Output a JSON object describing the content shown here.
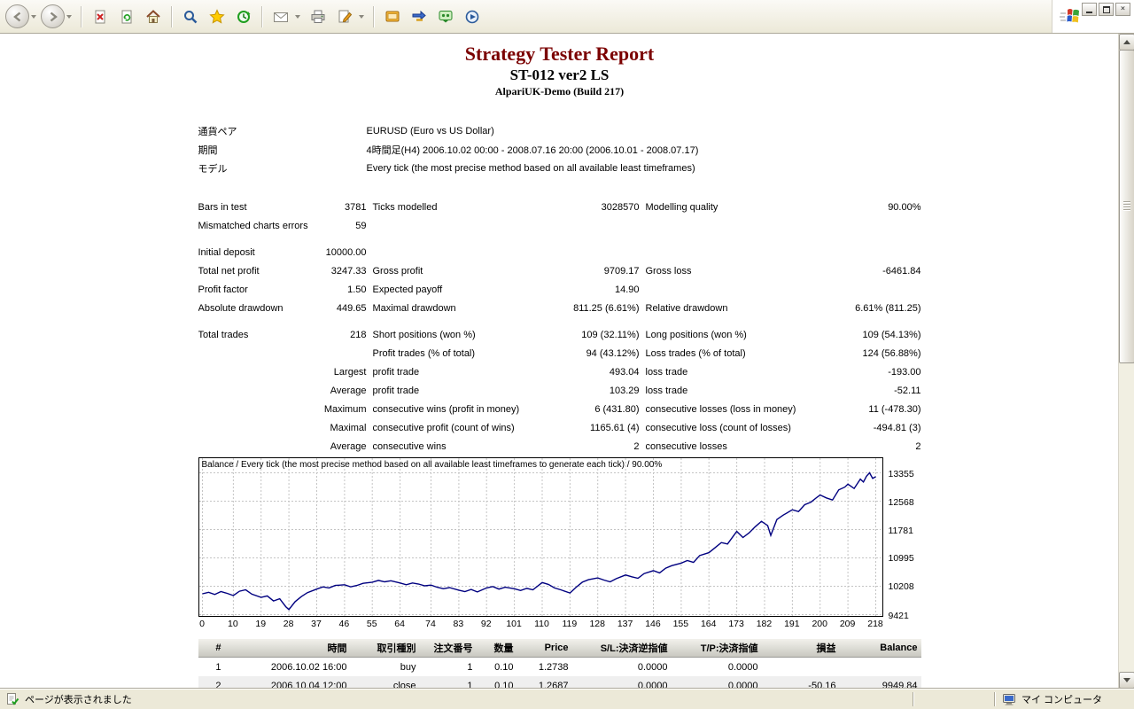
{
  "browser": {
    "toolbar_icons": [
      "back-icon",
      "forward-icon",
      "stop-icon",
      "refresh-icon",
      "home-icon",
      "search-icon",
      "favorites-icon",
      "history-icon",
      "mail-icon",
      "print-icon",
      "edit-icon",
      "tool-icon",
      "transfer-icon",
      "messenger-icon",
      "media-icon"
    ],
    "window_buttons": [
      "minimize",
      "restore",
      "close"
    ],
    "status": {
      "left": "ページが表示されました",
      "zone": "マイ コンピュータ"
    }
  },
  "report": {
    "title": "Strategy Tester Report",
    "subtitle": "ST-012 ver2 LS",
    "server": "AlpariUK-Demo (Build 217)",
    "info": [
      {
        "label": "通貨ペア",
        "value": "EURUSD (Euro vs US Dollar)"
      },
      {
        "label": "期間",
        "value": "4時間足(H4) 2006.10.02 00:00 - 2008.07.16 20:00 (2006.10.01 - 2008.07.17)"
      },
      {
        "label": "モデル",
        "value": "Every tick (the most precise method based on all available least timeframes)"
      }
    ],
    "stats_rows": [
      [
        "Bars in test",
        "3781",
        "Ticks modelled",
        "3028570",
        "Modelling quality",
        "90.00%"
      ],
      [
        "Mismatched charts errors",
        "59",
        "",
        "",
        "",
        ""
      ],
      [],
      [
        "Initial deposit",
        "10000.00",
        "",
        "",
        "",
        ""
      ],
      [
        "Total net profit",
        "3247.33",
        "Gross profit",
        "9709.17",
        "Gross loss",
        "-6461.84"
      ],
      [
        "Profit factor",
        "1.50",
        "Expected payoff",
        "14.90",
        "",
        ""
      ],
      [
        "Absolute drawdown",
        "449.65",
        "Maximal drawdown",
        "811.25 (6.61%)",
        "Relative drawdown",
        "6.61% (811.25)"
      ],
      [],
      [
        "Total trades",
        "218",
        "Short positions (won %)",
        "109 (32.11%)",
        "Long positions (won %)",
        "109 (54.13%)"
      ],
      [
        "",
        "",
        "Profit trades (% of total)",
        "94 (43.12%)",
        "Loss trades (% of total)",
        "124 (56.88%)"
      ],
      [
        "",
        "Largest",
        "profit trade",
        "493.04",
        "loss trade",
        "-193.00"
      ],
      [
        "",
        "Average",
        "profit trade",
        "103.29",
        "loss trade",
        "-52.11"
      ],
      [
        "",
        "Maximum",
        "consecutive wins (profit in money)",
        "6 (431.80)",
        "consecutive losses (loss in money)",
        "11 (-478.30)"
      ],
      [
        "",
        "Maximal",
        "consecutive profit (count of wins)",
        "1165.61 (4)",
        "consecutive loss (count of losses)",
        "-494.81 (3)"
      ],
      [
        "",
        "Average",
        "consecutive wins",
        "2",
        "consecutive losses",
        "2"
      ]
    ],
    "trades": {
      "headers": [
        "#",
        "時間",
        "取引種別",
        "注文番号",
        "数量",
        "Price",
        "S/L:決済逆指値",
        "T/P:決済指値",
        "損益",
        "Balance"
      ],
      "rows": [
        [
          "1",
          "2006.10.02 16:00",
          "buy",
          "1",
          "0.10",
          "1.2738",
          "0.0000",
          "0.0000",
          "",
          ""
        ],
        [
          "2",
          "2006.10.04 12:00",
          "close",
          "1",
          "0.10",
          "1.2687",
          "0.0000",
          "0.0000",
          "-50.16",
          "9949.84"
        ]
      ]
    }
  },
  "chart_data": {
    "type": "line",
    "title": "Balance / Every tick (the most precise method based on all available least timeframes to generate each tick) / 90.00%",
    "series_name": "Balance",
    "x_range": [
      0,
      218
    ],
    "y_range": [
      9421,
      13355
    ],
    "x_ticks": [
      0,
      10,
      19,
      28,
      37,
      46,
      55,
      64,
      74,
      83,
      92,
      101,
      110,
      119,
      128,
      137,
      146,
      155,
      164,
      173,
      182,
      191,
      200,
      209,
      218
    ],
    "y_ticks": [
      9421,
      10208,
      10995,
      11781,
      12568,
      13355
    ],
    "line_color": "#000080",
    "grid": true,
    "points": [
      [
        0,
        10000
      ],
      [
        2,
        10040
      ],
      [
        4,
        9980
      ],
      [
        6,
        10060
      ],
      [
        8,
        10010
      ],
      [
        10,
        9950
      ],
      [
        12,
        10070
      ],
      [
        14,
        10110
      ],
      [
        16,
        9990
      ],
      [
        19,
        9900
      ],
      [
        21,
        9940
      ],
      [
        23,
        9800
      ],
      [
        25,
        9860
      ],
      [
        27,
        9640
      ],
      [
        28,
        9560
      ],
      [
        30,
        9780
      ],
      [
        32,
        9920
      ],
      [
        34,
        10030
      ],
      [
        37,
        10130
      ],
      [
        39,
        10190
      ],
      [
        41,
        10160
      ],
      [
        43,
        10230
      ],
      [
        46,
        10250
      ],
      [
        48,
        10190
      ],
      [
        50,
        10230
      ],
      [
        52,
        10290
      ],
      [
        55,
        10320
      ],
      [
        57,
        10370
      ],
      [
        59,
        10330
      ],
      [
        61,
        10360
      ],
      [
        64,
        10300
      ],
      [
        66,
        10250
      ],
      [
        68,
        10300
      ],
      [
        70,
        10270
      ],
      [
        72,
        10220
      ],
      [
        74,
        10240
      ],
      [
        76,
        10180
      ],
      [
        78,
        10140
      ],
      [
        80,
        10170
      ],
      [
        83,
        10100
      ],
      [
        85,
        10060
      ],
      [
        87,
        10120
      ],
      [
        89,
        10050
      ],
      [
        92,
        10160
      ],
      [
        94,
        10200
      ],
      [
        96,
        10130
      ],
      [
        98,
        10180
      ],
      [
        101,
        10140
      ],
      [
        103,
        10090
      ],
      [
        105,
        10150
      ],
      [
        107,
        10110
      ],
      [
        110,
        10310
      ],
      [
        112,
        10260
      ],
      [
        114,
        10160
      ],
      [
        116,
        10110
      ],
      [
        119,
        10020
      ],
      [
        121,
        10180
      ],
      [
        123,
        10320
      ],
      [
        125,
        10390
      ],
      [
        128,
        10440
      ],
      [
        130,
        10380
      ],
      [
        132,
        10330
      ],
      [
        134,
        10420
      ],
      [
        137,
        10520
      ],
      [
        139,
        10470
      ],
      [
        141,
        10430
      ],
      [
        143,
        10560
      ],
      [
        146,
        10640
      ],
      [
        148,
        10580
      ],
      [
        150,
        10710
      ],
      [
        152,
        10780
      ],
      [
        155,
        10850
      ],
      [
        157,
        10920
      ],
      [
        159,
        10870
      ],
      [
        161,
        11060
      ],
      [
        164,
        11140
      ],
      [
        166,
        11280
      ],
      [
        168,
        11420
      ],
      [
        170,
        11380
      ],
      [
        173,
        11730
      ],
      [
        175,
        11560
      ],
      [
        177,
        11690
      ],
      [
        179,
        11860
      ],
      [
        181,
        12010
      ],
      [
        183,
        11890
      ],
      [
        184,
        11620
      ],
      [
        186,
        12060
      ],
      [
        188,
        12180
      ],
      [
        191,
        12330
      ],
      [
        193,
        12280
      ],
      [
        195,
        12470
      ],
      [
        197,
        12540
      ],
      [
        199,
        12680
      ],
      [
        200,
        12740
      ],
      [
        202,
        12660
      ],
      [
        204,
        12600
      ],
      [
        206,
        12880
      ],
      [
        208,
        12960
      ],
      [
        209,
        13040
      ],
      [
        211,
        12920
      ],
      [
        213,
        13180
      ],
      [
        214,
        13100
      ],
      [
        215,
        13260
      ],
      [
        216,
        13355
      ],
      [
        217,
        13200
      ],
      [
        218,
        13247
      ]
    ]
  }
}
